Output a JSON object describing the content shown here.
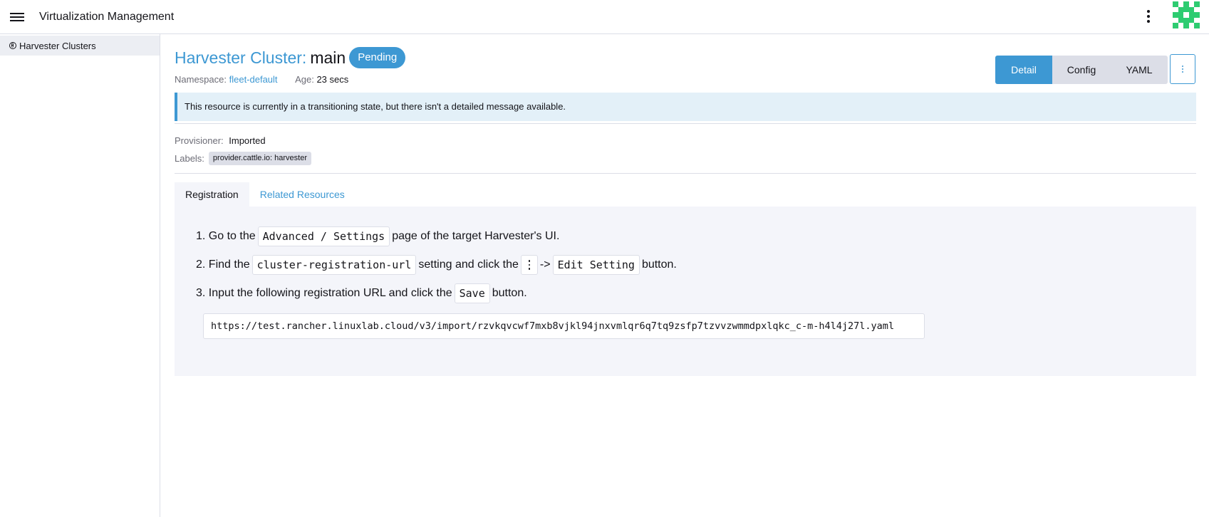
{
  "header": {
    "title": "Virtualization Management",
    "menu_icon": "hamburger-icon",
    "more_icon": "vertical-ellipsis-icon",
    "avatar_icon": "identicon-avatar"
  },
  "sidebar": {
    "items": [
      {
        "label": "Harvester Clusters",
        "icon": "globe-icon"
      }
    ]
  },
  "resource": {
    "type_label": "Harvester Cluster:",
    "name": "main",
    "state": "Pending",
    "namespace_label": "Namespace:",
    "namespace": "fleet-default",
    "age_label": "Age:",
    "age": "23 secs"
  },
  "view_buttons": {
    "detail": "Detail",
    "config": "Config",
    "yaml": "YAML"
  },
  "banner": {
    "message": "This resource is currently in a transitioning state, but there isn't a detailed message available."
  },
  "details": {
    "provisioner_label": "Provisioner:",
    "provisioner": "Imported",
    "labels_label": "Labels:",
    "labels": [
      "provider.cattle.io: harvester"
    ]
  },
  "tabs": [
    {
      "label": "Registration",
      "active": true
    },
    {
      "label": "Related Resources",
      "active": false
    }
  ],
  "registration": {
    "step1": {
      "num": "1.",
      "pre": "Go to the",
      "code": "Advanced / Settings",
      "post": "page of the target Harvester's UI."
    },
    "step2": {
      "num": "2.",
      "pre": "Find the",
      "code": "cluster-registration-url",
      "mid": "setting and click the",
      "arrow": "->",
      "code2": "Edit Setting",
      "post": "button."
    },
    "step3": {
      "num": "3.",
      "pre": "Input the following registration URL and click the",
      "code": "Save",
      "post": "button."
    },
    "url": "https://test.rancher.linuxlab.cloud/v3/import/rzvkqvcwf7mxb8vjkl94jnxvmlqr6q7tq9zsfp7tzvvzwmmdpxlqkc_c-m-h4l4j27l.yaml"
  },
  "colors": {
    "accent": "#3d98d3",
    "banner_bg": "#e3f0f8",
    "panel_bg": "#f4f5fa",
    "avatar_green": "#2ecc71"
  }
}
